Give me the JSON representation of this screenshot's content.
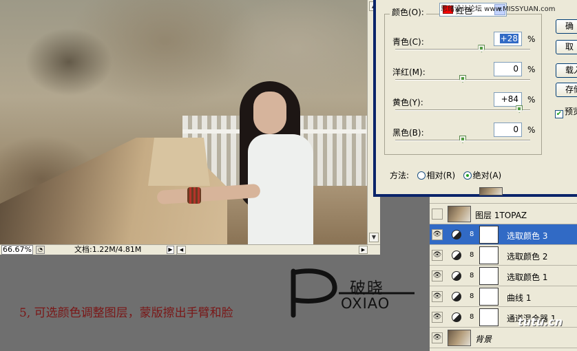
{
  "watermark": "思绪设计论坛 www.MISSYUAN.com",
  "photo_window": {
    "zoom": "66.67%",
    "doc_size": "文档:1.22M/4.81M"
  },
  "dialog": {
    "colors_label": "颜色(O):",
    "colors_value": "红色",
    "colors_swatch": "#ff0000",
    "sliders": [
      {
        "label": "青色(C):",
        "value": "+28",
        "percent": "%",
        "level": 28
      },
      {
        "label": "洋红(M):",
        "value": "0",
        "percent": "%",
        "level": 0
      },
      {
        "label": "黄色(Y):",
        "value": "+84",
        "percent": "%",
        "level": 84
      },
      {
        "label": "黑色(B):",
        "value": "0",
        "percent": "%",
        "level": 0
      }
    ],
    "method_label": "方法:",
    "method_relative": "相对(R)",
    "method_absolute": "绝对(A)",
    "method_selected": "absolute",
    "buttons": [
      "确",
      "取",
      "载入",
      "存储"
    ],
    "preview_label": "预览",
    "preview_checked": true
  },
  "layers": [
    {
      "name": "",
      "kind": "partial",
      "visible": false,
      "selected": false
    },
    {
      "name": "图层 1TOPAZ",
      "kind": "photo",
      "visible": false,
      "selected": false
    },
    {
      "name": "选取颜色 3",
      "kind": "adjustment",
      "visible": true,
      "selected": true
    },
    {
      "name": "选取颜色 2",
      "kind": "adjustment",
      "visible": true,
      "selected": false
    },
    {
      "name": "选取颜色 1",
      "kind": "adjustment",
      "visible": true,
      "selected": false
    },
    {
      "name": "曲线 1",
      "kind": "adjustment",
      "visible": true,
      "selected": false
    },
    {
      "name": "通道混合器 1",
      "kind": "adjustment",
      "visible": true,
      "selected": false
    },
    {
      "name": "背景",
      "kind": "photo",
      "visible": true,
      "selected": false
    }
  ],
  "caption": "5, 可选颜色调整图层，蒙版擦出手臂和脸",
  "logo": {
    "chinese": "破晓",
    "pinyin": "OXIAO"
  },
  "site_logo": "tutu.cn",
  "colors": {
    "selection": "#316ac5",
    "dialog_frame": "#0a246a",
    "caption": "#7a1717"
  }
}
